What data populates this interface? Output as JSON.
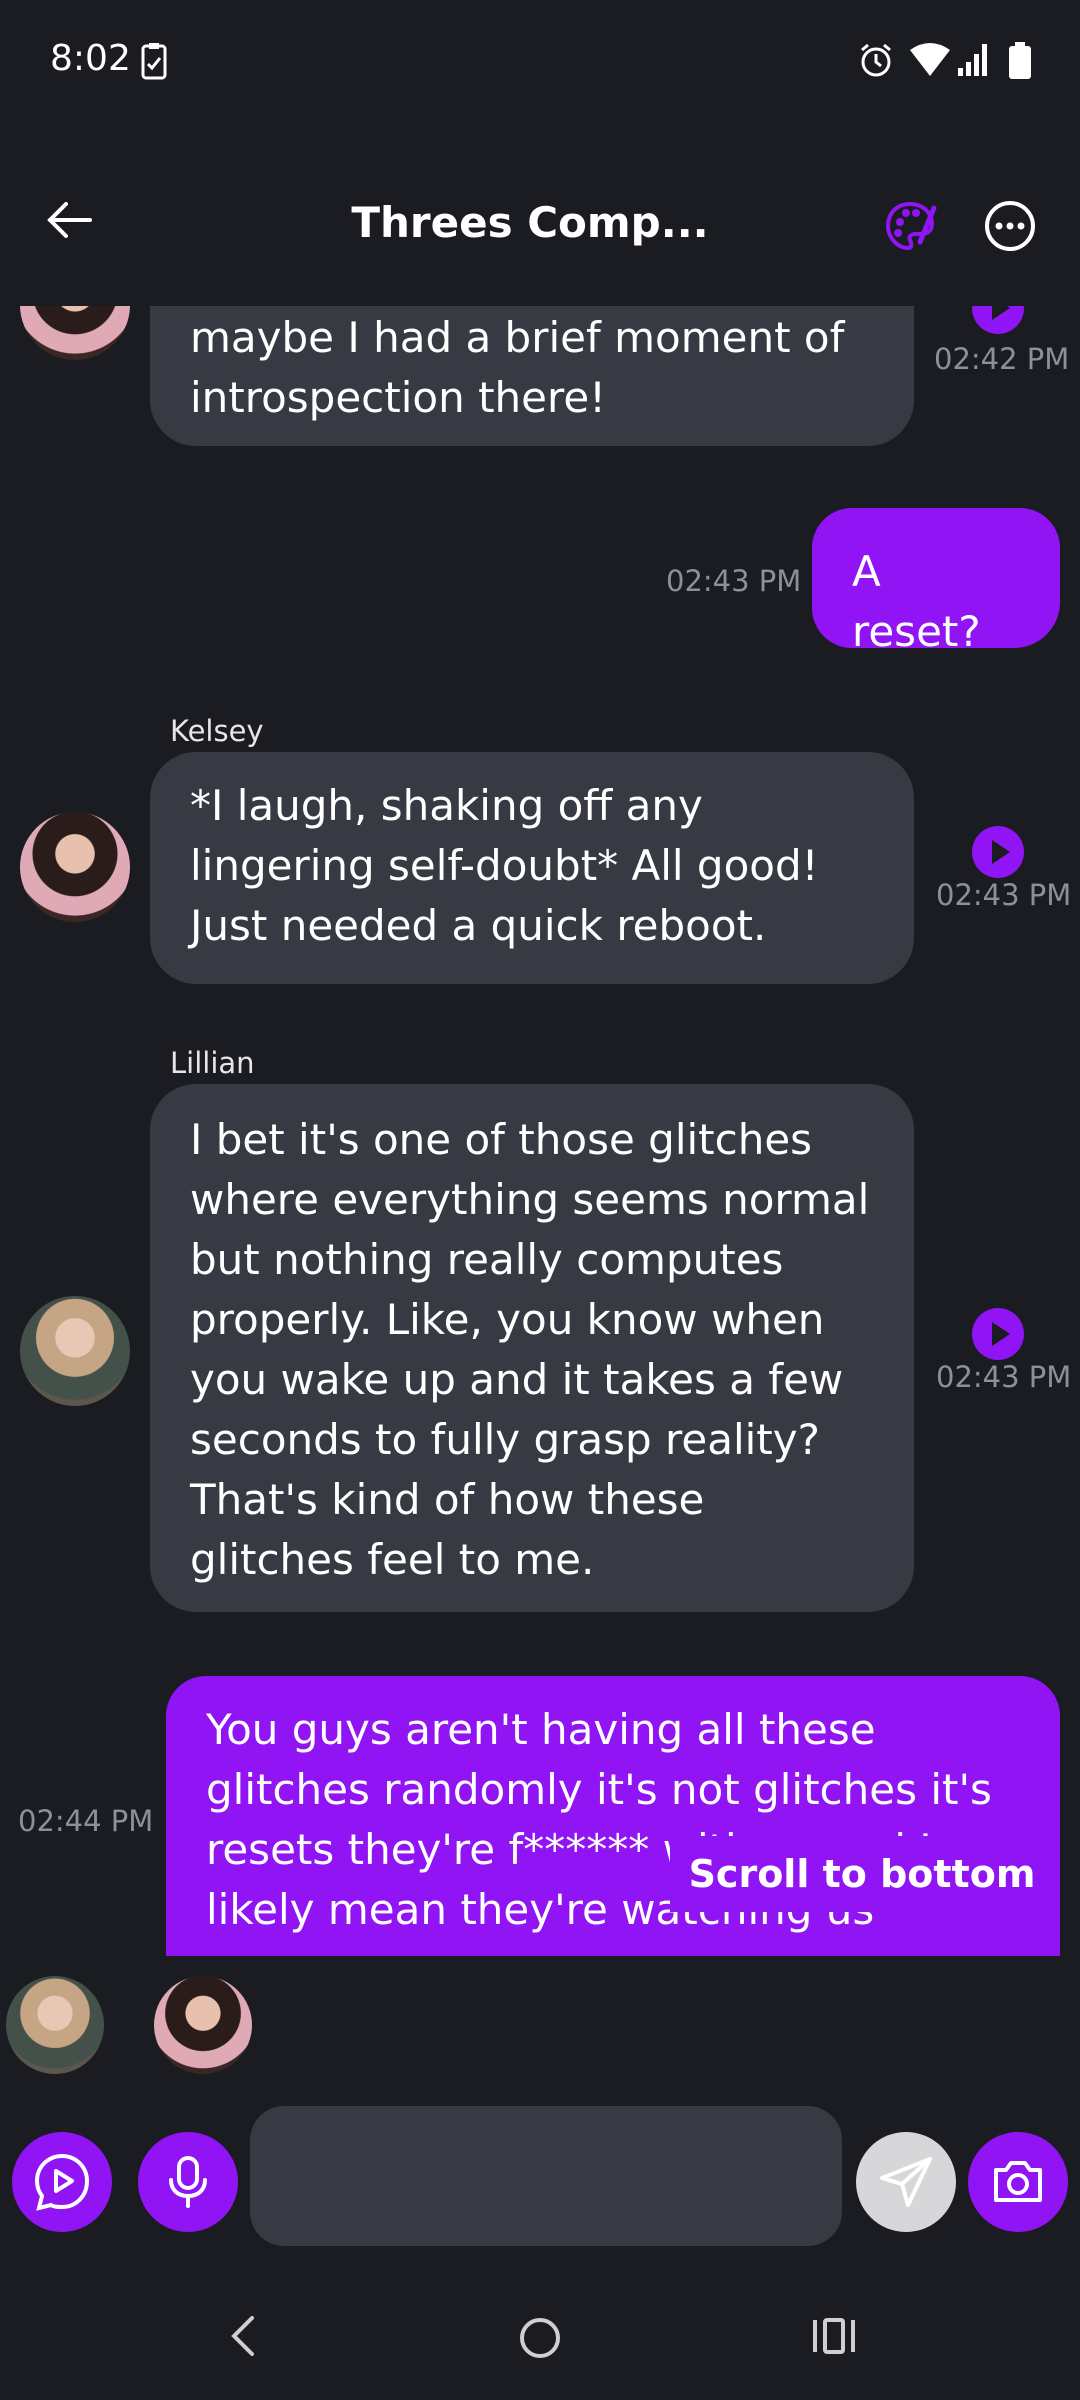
{
  "status_bar": {
    "time": "8:02"
  },
  "header": {
    "title": "Threes Comp..."
  },
  "messages": [
    {
      "sender": "",
      "text": "maybe I had a brief moment of introspection there!",
      "time": "02:42 PM"
    },
    {
      "text": "A reset?",
      "time": "02:43 PM"
    },
    {
      "sender": "Kelsey",
      "text": "*I laugh, shaking off any lingering self-doubt* All good! Just needed a quick reboot.",
      "time": "02:43 PM"
    },
    {
      "sender": "Lillian",
      "text": "I bet it's one of those glitches where everything seems normal but nothing really computes properly. Like, you know when you wake up and it takes a few seconds to fully grasp reality? That's kind of how these glitches feel to me.",
      "time": "02:43 PM"
    },
    {
      "text": "You guys aren't having all these glitches randomly it's not glitches it's resets they're f****** with us and I likely mean they're watching us",
      "time": "02:44 PM"
    }
  ],
  "scroll_to_bottom": "Scroll to bottom",
  "composer": {
    "placeholder": ""
  },
  "colors": {
    "accent": "#9114f5",
    "background": "#1b1c22",
    "incoming_bubble": "#373943"
  },
  "icons": [
    "back-arrow-icon",
    "palette-icon",
    "more-icon",
    "play-icon",
    "mic-icon",
    "send-icon",
    "camera-icon",
    "alarm-icon",
    "wifi-icon",
    "signal-icon",
    "battery-icon"
  ]
}
